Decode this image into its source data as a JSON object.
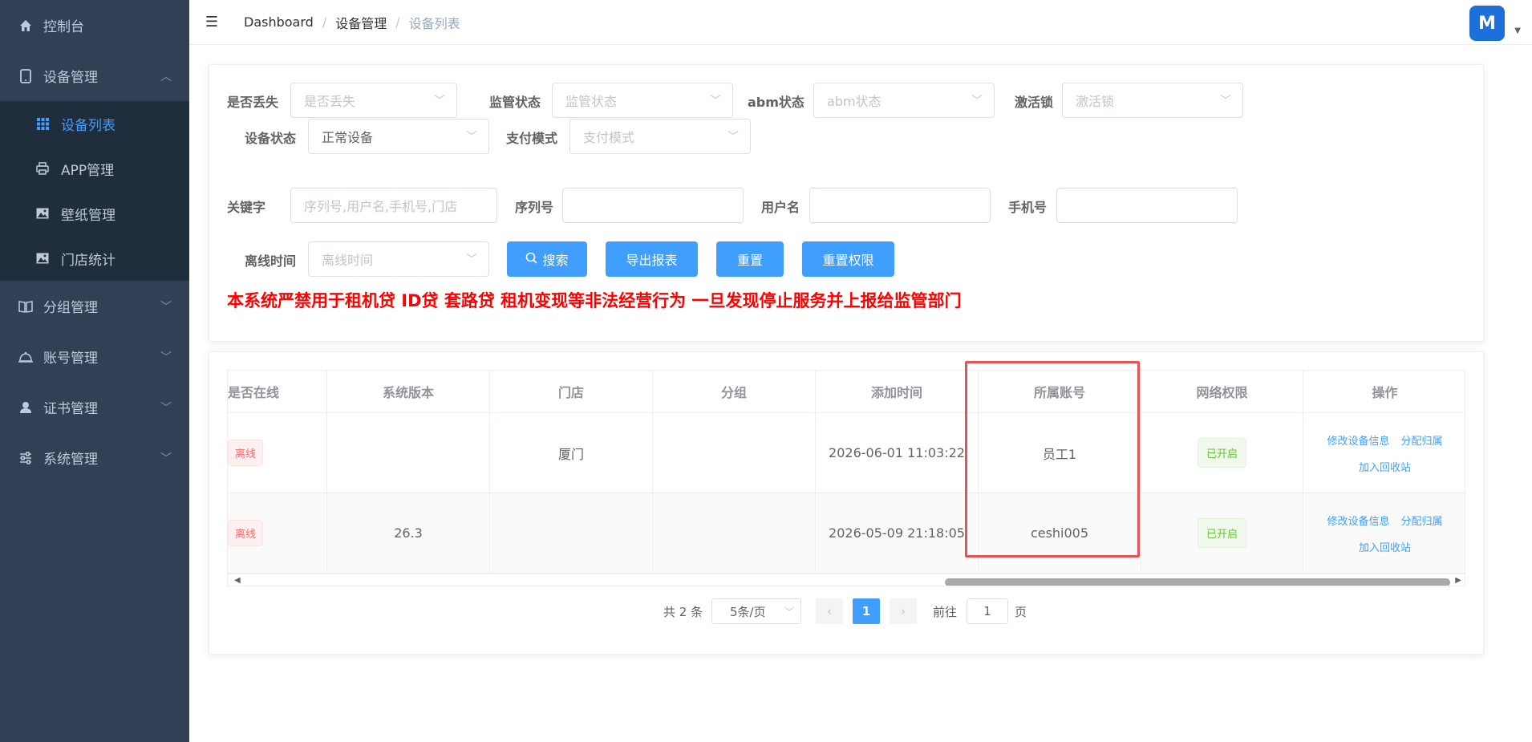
{
  "sidebar": {
    "items": [
      {
        "label": "控制台",
        "icon": "home-icon"
      },
      {
        "label": "设备管理",
        "icon": "tablet-icon",
        "expanded": true,
        "children": [
          {
            "label": "设备列表",
            "icon": "grid-icon",
            "active": true
          },
          {
            "label": "APP管理",
            "icon": "printer-icon"
          },
          {
            "label": "壁纸管理",
            "icon": "picture-icon"
          },
          {
            "label": "门店统计",
            "icon": "picture-icon"
          }
        ]
      },
      {
        "label": "分组管理",
        "icon": "book-icon"
      },
      {
        "label": "账号管理",
        "icon": "bell-icon"
      },
      {
        "label": "证书管理",
        "icon": "user-icon"
      },
      {
        "label": "系统管理",
        "icon": "sliders-icon"
      }
    ]
  },
  "navbar": {
    "breadcrumb": [
      "Dashboard",
      "设备管理",
      "设备列表"
    ],
    "avatar_text": "M"
  },
  "filters": {
    "lost": {
      "label": "是否丢失",
      "placeholder": "是否丢失"
    },
    "supervise": {
      "label": "监管状态",
      "placeholder": "监管状态"
    },
    "abm": {
      "label": "abm状态",
      "placeholder": "abm状态"
    },
    "lock": {
      "label": "激活锁",
      "placeholder": "激活锁"
    },
    "device_status": {
      "label": "设备状态",
      "value": "正常设备"
    },
    "pay_mode": {
      "label": "支付模式",
      "placeholder": "支付模式"
    },
    "keyword": {
      "label": "关键字",
      "placeholder": "序列号,用户名,手机号,门店"
    },
    "serial": {
      "label": "序列号",
      "placeholder": ""
    },
    "username": {
      "label": "用户名",
      "placeholder": ""
    },
    "phone": {
      "label": "手机号",
      "placeholder": ""
    },
    "offline_time": {
      "label": "离线时间",
      "placeholder": "离线时间"
    }
  },
  "buttons": {
    "search": "搜索",
    "export": "导出报表",
    "reset": "重置",
    "reset_perm": "重置权限"
  },
  "warning": "本系统严禁用于租机贷 ID贷 套路贷 租机变现等非法经营行为 一旦发现停止服务并上报给监管部门",
  "table": {
    "columns": [
      "是否在线",
      "系统版本",
      "门店",
      "分组",
      "添加时间",
      "所属账号",
      "网络权限",
      "操作"
    ],
    "rows": [
      {
        "online": "离线",
        "version": "",
        "store": "厦门",
        "group": "",
        "added": "2026-06-01 11:03:22",
        "account": "员工1",
        "network": "已开启"
      },
      {
        "online": "离线",
        "version": "26.3",
        "store": "",
        "group": "",
        "added": "2026-05-09 21:18:05",
        "account": "ceshi005",
        "network": "已开启"
      }
    ],
    "ops": {
      "edit": "修改设备信息",
      "assign": "分配归属",
      "recycle": "加入回收站"
    }
  },
  "pagination": {
    "total": "共 2 条",
    "page_size": "5条/页",
    "current": "1",
    "goto_label": "前往",
    "goto_value": "1",
    "page_suffix": "页"
  },
  "colors": {
    "sidebar_bg": "#304156",
    "submenu_bg": "#1f2d3d",
    "primary": "#409eff",
    "warning_text": "#ff0000",
    "highlight_box": "#e55353"
  }
}
